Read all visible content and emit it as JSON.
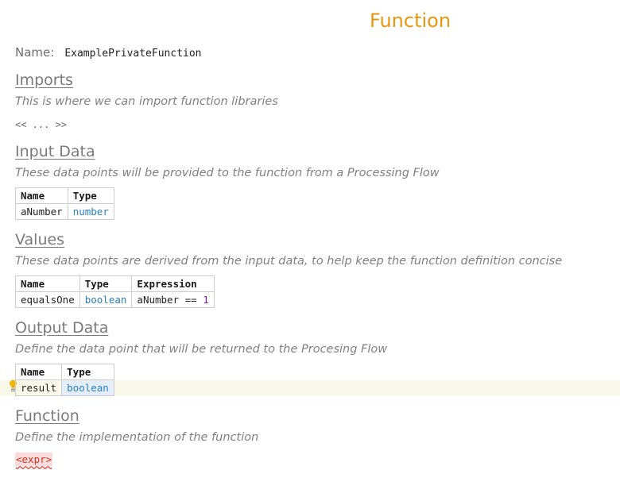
{
  "header": {
    "title": "Function"
  },
  "name": {
    "label": "Name:",
    "value": "ExamplePrivateFunction"
  },
  "imports": {
    "title": "Imports",
    "description": "This is where we can import function libraries",
    "placeholder": "<< ... >>"
  },
  "input_data": {
    "title": "Input Data",
    "description": "These data points will be provided to the function from a Processing Flow",
    "columns": [
      "Name",
      "Type"
    ],
    "rows": [
      {
        "name": "aNumber",
        "type": "number"
      }
    ]
  },
  "values": {
    "title": "Values",
    "description": "These data points are derived from the input data, to help keep the function definition concise",
    "columns": [
      "Name",
      "Type",
      "Expression"
    ],
    "rows": [
      {
        "name": "equalsOne",
        "type": "boolean",
        "expression_lhs": "aNumber == ",
        "expression_rhs": "1"
      }
    ]
  },
  "output_data": {
    "title": "Output Data",
    "description": "Define the data point that will be returned to the Procesing Flow",
    "columns": [
      "Name",
      "Type"
    ],
    "rows": [
      {
        "name": "result",
        "type": "boolean"
      }
    ]
  },
  "function": {
    "title": "Function",
    "description": "Define the implementation of the function",
    "expr_placeholder": "<expr>"
  },
  "icons": {
    "intention": "lightbulb-icon"
  },
  "colors": {
    "title": "#e8960f",
    "type_keyword": "#2b7fc1",
    "number_literal": "#7a1f9e",
    "error": "#e03c31"
  }
}
